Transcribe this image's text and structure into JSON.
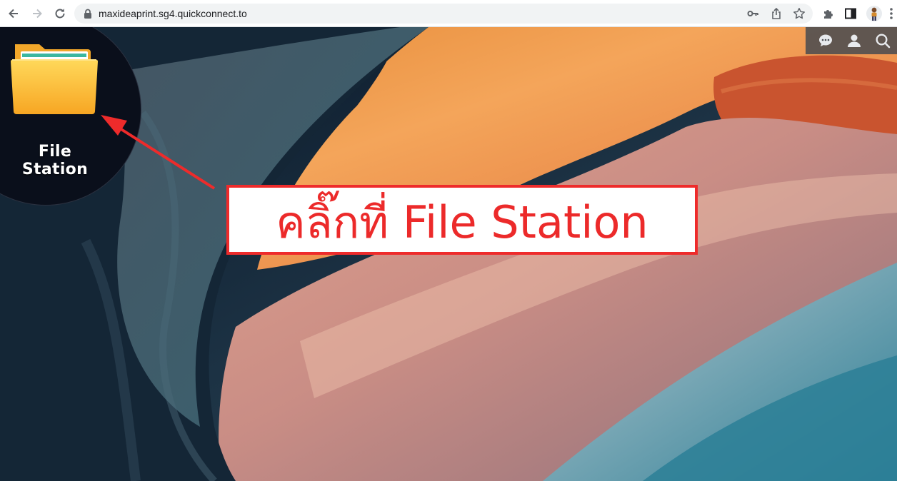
{
  "browser": {
    "url": "maxideaprint.sg4.quickconnect.to",
    "icons": [
      "back-icon",
      "forward-icon",
      "reload-icon",
      "lock-icon",
      "key-icon",
      "share-icon",
      "star-icon",
      "extensions-icon",
      "sidepanel-icon",
      "profile-avatar",
      "menu-icon"
    ]
  },
  "desktop": {
    "apps": [
      {
        "label": "File Station",
        "icon": "folder-icon"
      }
    ],
    "tray_icons": [
      "chat-icon",
      "user-icon",
      "search-icon"
    ]
  },
  "annotation": {
    "callout_text": "คลิ๊กที่ File Station",
    "color": "#ee2b2b"
  }
}
